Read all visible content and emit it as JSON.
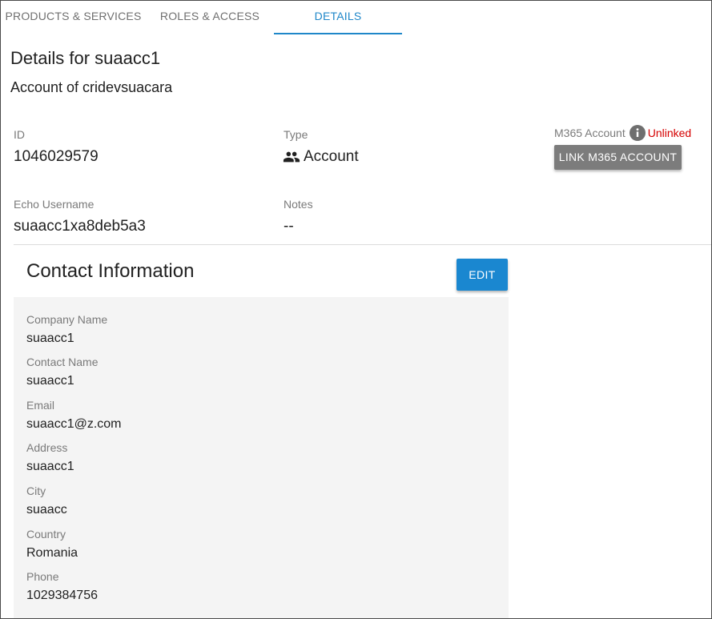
{
  "tabs": [
    {
      "label": "PRODUCTS & SERVICES"
    },
    {
      "label": "ROLES & ACCESS"
    },
    {
      "label": "DETAILS",
      "active": true
    }
  ],
  "header": {
    "title": "Details for suaacc1",
    "subtitle": "Account of cridevsuacara"
  },
  "fields": {
    "id": {
      "label": "ID",
      "value": "1046029579"
    },
    "type": {
      "label": "Type",
      "value": "Account",
      "icon": "people-icon"
    },
    "m365": {
      "label": "M365 Account",
      "status": "Unlinked",
      "button": "LINK M365 ACCOUNT",
      "icon": "info-icon"
    },
    "echo": {
      "label": "Echo Username",
      "value": "suaacc1xa8deb5a3"
    },
    "notes": {
      "label": "Notes",
      "value": "--"
    }
  },
  "contact": {
    "title": "Contact Information",
    "edit_label": "EDIT",
    "items": [
      {
        "label": "Company Name",
        "value": "suaacc1"
      },
      {
        "label": "Contact Name",
        "value": "suaacc1"
      },
      {
        "label": "Email",
        "value": "suaacc1@z.com"
      },
      {
        "label": "Address",
        "value": "suaacc1"
      },
      {
        "label": "City",
        "value": "suaacc"
      },
      {
        "label": "Country",
        "value": "Romania"
      },
      {
        "label": "Phone",
        "value": "1029384756"
      }
    ]
  },
  "colors": {
    "accent": "#1f87c9",
    "edit_button": "#1a87d0",
    "link_button": "#7c7c7c",
    "unlinked": "#d50000",
    "panel_bg": "#f4f4f4"
  }
}
